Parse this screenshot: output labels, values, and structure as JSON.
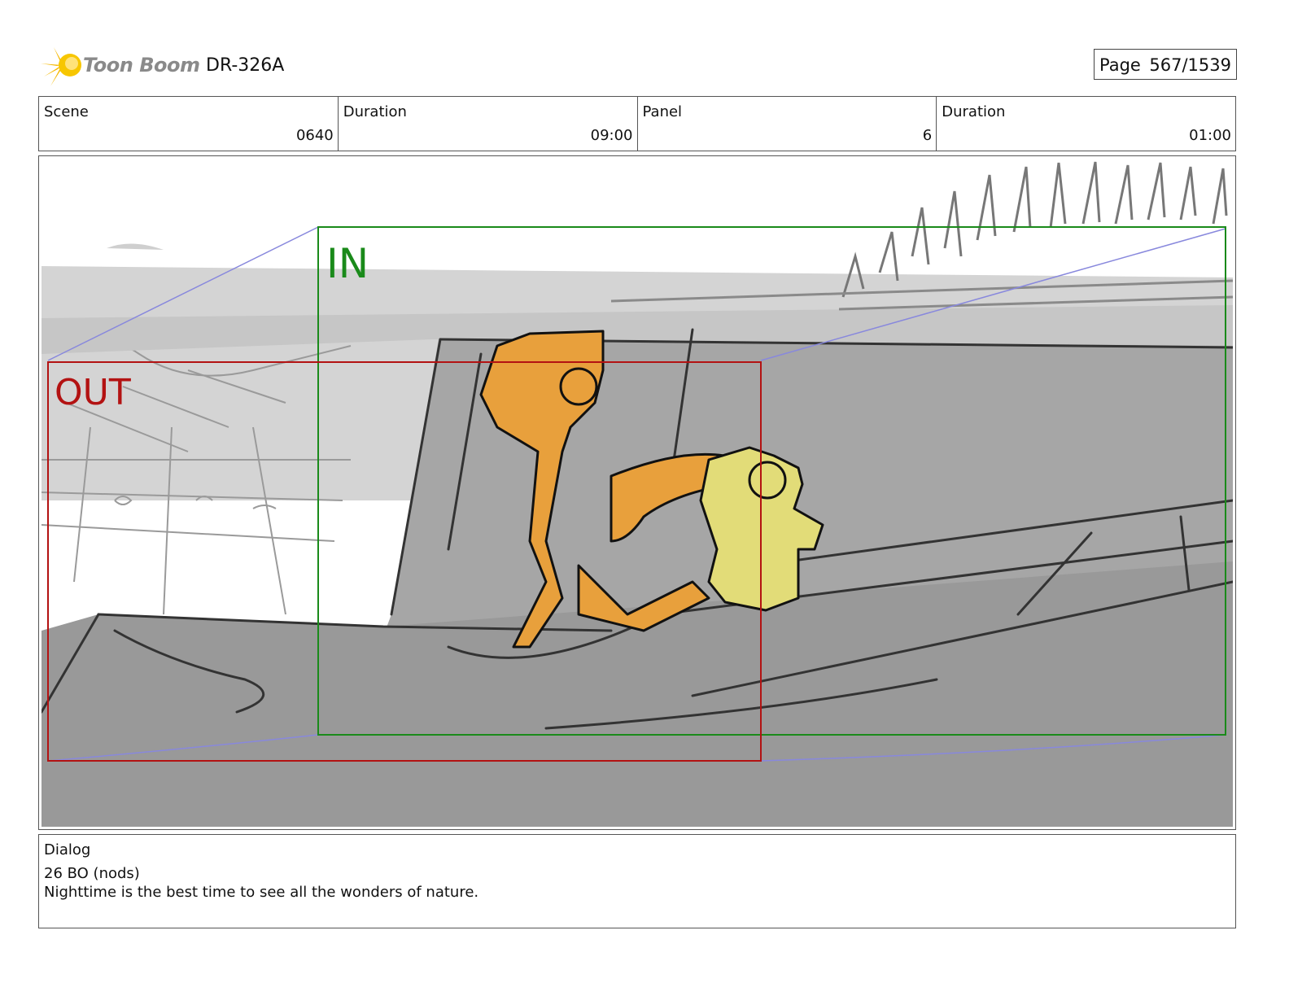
{
  "header": {
    "brand": "Toon Boom",
    "doc_id": "DR-326A",
    "page_label": "Page",
    "page_number": "567/1539"
  },
  "info": [
    {
      "label": "Scene",
      "value": "0640"
    },
    {
      "label": "Duration",
      "value": "09:00"
    },
    {
      "label": "Panel",
      "value": "6"
    },
    {
      "label": "Duration",
      "value": "01:00"
    }
  ],
  "panel": {
    "in_label": "IN",
    "out_label": "OUT",
    "colors": {
      "in_frame": "#1a8a1a",
      "out_frame": "#b31212",
      "camera_path": "#8888dd",
      "character_orange": "#e8a03c",
      "character_yellow": "#e2dc78"
    }
  },
  "dialog": {
    "label": "Dialog",
    "line1": "26 BO (nods)",
    "line2": "Nighttime is the best time to see all the wonders of nature."
  }
}
